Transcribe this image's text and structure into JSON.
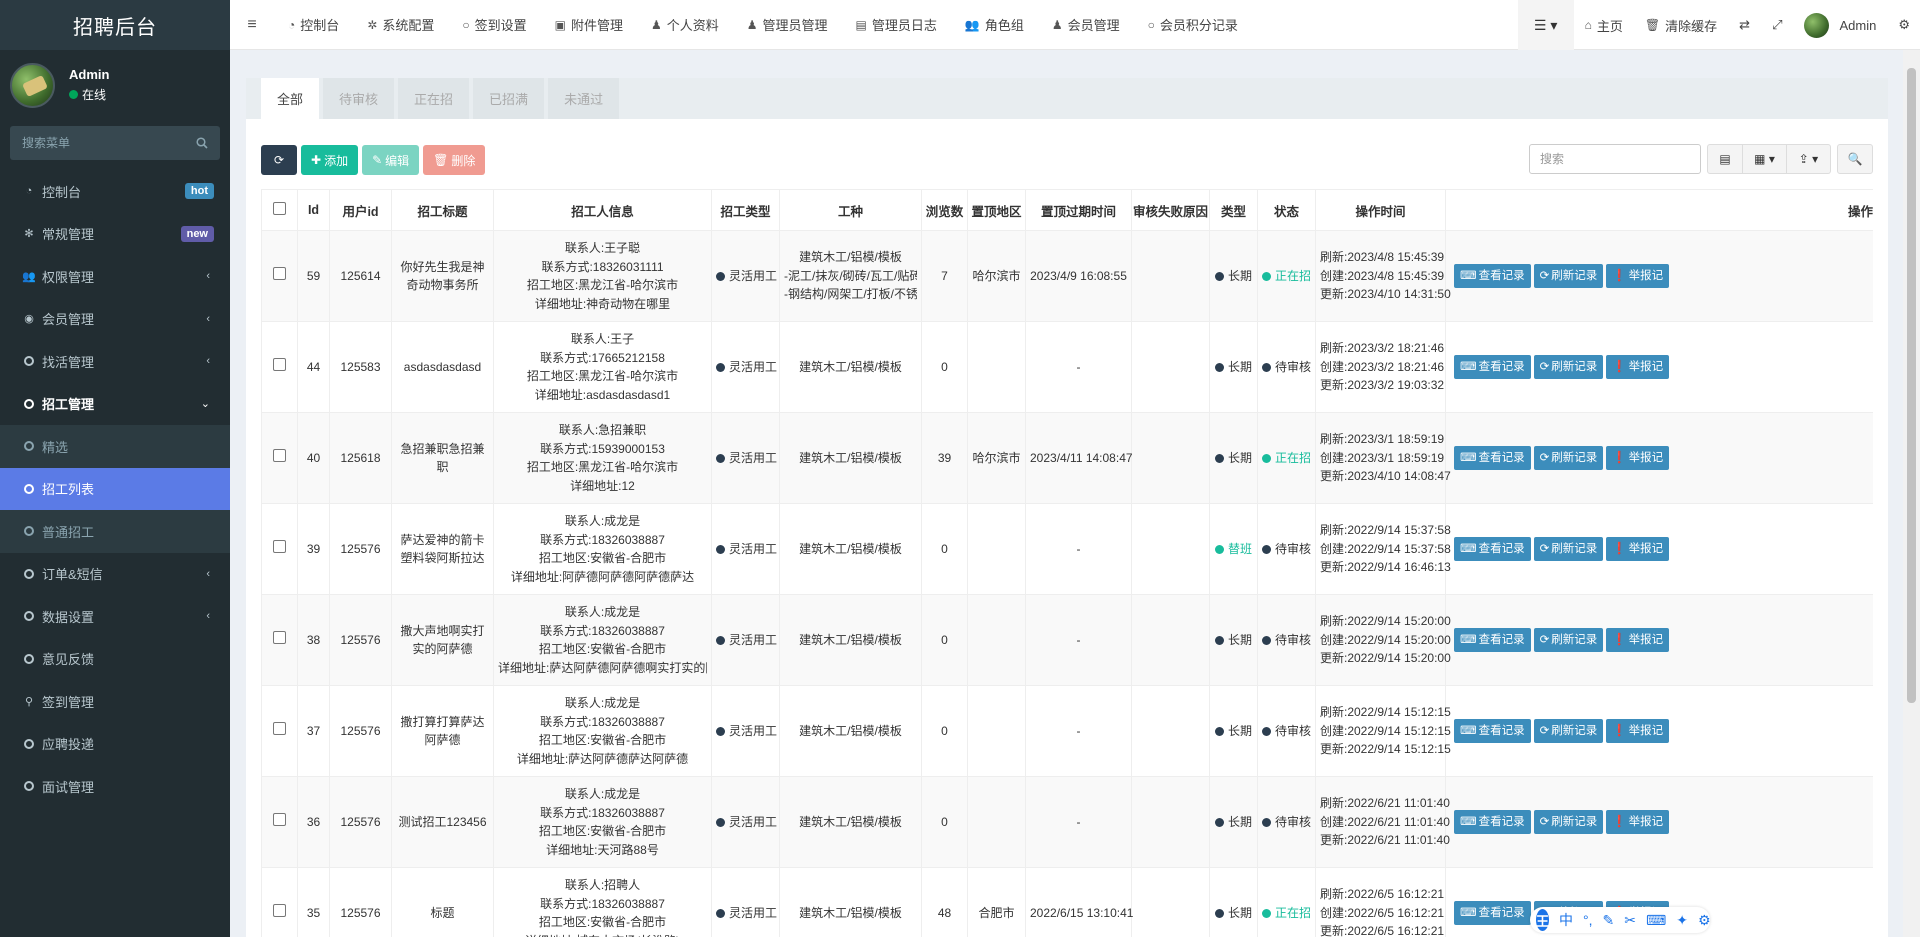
{
  "brand": "招聘后台",
  "user": {
    "name": "Admin",
    "status": "在线"
  },
  "search_menu": {
    "placeholder": "搜索菜单"
  },
  "sidebar": {
    "items": [
      {
        "label": "控制台",
        "icon": "dashboard-icon",
        "badge": "hot"
      },
      {
        "label": "常规管理",
        "icon": "cogs-icon",
        "badge": "new"
      },
      {
        "label": "权限管理",
        "icon": "group-icon"
      },
      {
        "label": "会员管理",
        "icon": "user-circle-icon"
      },
      {
        "label": "找活管理",
        "icon": "circle-icon"
      },
      {
        "label": "招工管理",
        "icon": "circle-icon"
      },
      {
        "label": "订单&短信",
        "icon": "circle-icon"
      },
      {
        "label": "数据设置",
        "icon": "circle-icon"
      },
      {
        "label": "意见反馈",
        "icon": "circle-icon"
      },
      {
        "label": "签到管理",
        "icon": "map-marker-icon"
      },
      {
        "label": "应聘投递",
        "icon": "circle-icon"
      },
      {
        "label": "面试管理",
        "icon": "circle-icon"
      }
    ],
    "submenu": [
      {
        "label": "精选"
      },
      {
        "label": "招工列表"
      },
      {
        "label": "普通招工"
      }
    ]
  },
  "navbar": {
    "links": [
      {
        "label": "控制台",
        "icon": "dashboard-icon"
      },
      {
        "label": "系统配置",
        "icon": "gear-icon"
      },
      {
        "label": "签到设置",
        "icon": "circle-icon"
      },
      {
        "label": "附件管理",
        "icon": "file-image-icon"
      },
      {
        "label": "个人资料",
        "icon": "user-icon"
      },
      {
        "label": "管理员管理",
        "icon": "user-icon"
      },
      {
        "label": "管理员日志",
        "icon": "list-alt-icon"
      },
      {
        "label": "角色组",
        "icon": "group-icon"
      },
      {
        "label": "会员管理",
        "icon": "user-icon"
      },
      {
        "label": "会员积分记录",
        "icon": "circle-icon"
      }
    ],
    "home": "主页",
    "clear_cache": "清除缓存",
    "admin": "Admin"
  },
  "tabs": [
    "全部",
    "待审核",
    "正在招",
    "已招满",
    "未通过"
  ],
  "toolbar": {
    "add": "添加",
    "edit": "编辑",
    "delete": "删除",
    "search_placeholder": "搜索"
  },
  "table": {
    "headers": [
      "Id",
      "用户id",
      "招工标题",
      "招工人信息",
      "招工类型",
      "工种",
      "浏览数",
      "置顶地区",
      "置顶过期时间",
      "审核失败原因",
      "类型",
      "状态",
      "操作时间",
      "操作"
    ],
    "op_labels": [
      "查看记录",
      "刷新记录",
      "举报记"
    ],
    "rows": [
      {
        "id": "59",
        "uid": "125614",
        "title": "你好先生我是神奇动物事务所",
        "info": [
          "联系人:王子聪",
          "联系方式:18326031111",
          "招工地区:黑龙江省-哈尔滨市",
          "详细地址:神奇动物在哪里"
        ],
        "jtype": "灵活用工",
        "trade": [
          "建筑木工/铝模/模板",
          "-泥工/抹灰/砌砖/瓦工/贴砖",
          "-钢结构/网架工/打板/不锈钢"
        ],
        "views": "7",
        "region": "哈尔滨市",
        "expire": "2023/4/9 16:08:55",
        "reason": "",
        "type": "长期",
        "type_green": false,
        "status": "正在招",
        "status_green": true,
        "refresh": "刷新:2023/4/8 15:45:39",
        "create": "创建:2023/4/8 15:45:39",
        "update": "更新:2023/4/10 14:31:50"
      },
      {
        "id": "44",
        "uid": "125583",
        "title": "asdasdasdasd",
        "info": [
          "联系人:王子",
          "联系方式:17665212158",
          "招工地区:黑龙江省-哈尔滨市",
          "详细地址:asdasdasdasd1"
        ],
        "jtype": "灵活用工",
        "trade": [
          "建筑木工/铝模/模板"
        ],
        "views": "0",
        "region": "",
        "expire": "-",
        "reason": "",
        "type": "长期",
        "type_green": false,
        "status": "待审核",
        "status_green": false,
        "refresh": "刷新:2023/3/2 18:21:46",
        "create": "创建:2023/3/2 18:21:46",
        "update": "更新:2023/3/2 19:03:32"
      },
      {
        "id": "40",
        "uid": "125618",
        "title": "急招兼职急招兼职",
        "info": [
          "联系人:急招兼职",
          "联系方式:15939000153",
          "招工地区:黑龙江省-哈尔滨市",
          "详细地址:12"
        ],
        "jtype": "灵活用工",
        "trade": [
          "建筑木工/铝模/模板"
        ],
        "views": "39",
        "region": "哈尔滨市",
        "expire": "2023/4/11 14:08:47",
        "reason": "",
        "type": "长期",
        "type_green": false,
        "status": "正在招",
        "status_green": true,
        "refresh": "刷新:2023/3/1 18:59:19",
        "create": "创建:2023/3/1 18:59:19",
        "update": "更新:2023/4/10 14:08:47"
      },
      {
        "id": "39",
        "uid": "125576",
        "title": "萨达爱神的箭卡塑料袋阿斯拉达",
        "info": [
          "联系人:成龙是",
          "联系方式:18326038887",
          "招工地区:安徽省-合肥市",
          "详细地址:阿萨德阿萨德阿萨德萨达"
        ],
        "jtype": "灵活用工",
        "trade": [
          "建筑木工/铝模/模板"
        ],
        "views": "0",
        "region": "",
        "expire": "-",
        "reason": "",
        "type": "替班",
        "type_green": true,
        "status": "待审核",
        "status_green": false,
        "refresh": "刷新:2022/9/14 15:37:58",
        "create": "创建:2022/9/14 15:37:58",
        "update": "更新:2022/9/14 16:46:13"
      },
      {
        "id": "38",
        "uid": "125576",
        "title": "撒大声地啊实打实的阿萨德",
        "info": [
          "联系人:成龙是",
          "联系方式:18326038887",
          "招工地区:安徽省-合肥市",
          "详细地址:萨达阿萨德阿萨德啊实打实的阿萨"
        ],
        "jtype": "灵活用工",
        "trade": [
          "建筑木工/铝模/模板"
        ],
        "views": "0",
        "region": "",
        "expire": "-",
        "reason": "",
        "type": "长期",
        "type_green": false,
        "status": "待审核",
        "status_green": false,
        "refresh": "刷新:2022/9/14 15:20:00",
        "create": "创建:2022/9/14 15:20:00",
        "update": "更新:2022/9/14 15:20:00"
      },
      {
        "id": "37",
        "uid": "125576",
        "title": "撒打算打算萨达阿萨德",
        "info": [
          "联系人:成龙是",
          "联系方式:18326038887",
          "招工地区:安徽省-合肥市",
          "详细地址:萨达阿萨德萨达阿萨德"
        ],
        "jtype": "灵活用工",
        "trade": [
          "建筑木工/铝模/模板"
        ],
        "views": "0",
        "region": "",
        "expire": "-",
        "reason": "",
        "type": "长期",
        "type_green": false,
        "status": "待审核",
        "status_green": false,
        "refresh": "刷新:2022/9/14 15:12:15",
        "create": "创建:2022/9/14 15:12:15",
        "update": "更新:2022/9/14 15:12:15"
      },
      {
        "id": "36",
        "uid": "125576",
        "title": "测试招工123456",
        "info": [
          "联系人:成龙是",
          "联系方式:18326038887",
          "招工地区:安徽省-合肥市",
          "详细地址:天河路88号"
        ],
        "jtype": "灵活用工",
        "trade": [
          "建筑木工/铝模/模板"
        ],
        "views": "0",
        "region": "",
        "expire": "-",
        "reason": "",
        "type": "长期",
        "type_green": false,
        "status": "待审核",
        "status_green": false,
        "refresh": "刷新:2022/6/21 11:01:40",
        "create": "创建:2022/6/21 11:01:40",
        "update": "更新:2022/6/21 11:01:40"
      },
      {
        "id": "35",
        "uid": "125576",
        "title": "标题",
        "info": [
          "联系人:招聘人",
          "联系方式:18326038887",
          "招工地区:安徽省-合肥市",
          "详细地址:城东大市场(长淮路)"
        ],
        "jtype": "灵活用工",
        "trade": [
          "建筑木工/铝模/模板"
        ],
        "views": "48",
        "region": "合肥市",
        "expire": "2022/6/15 13:10:41",
        "reason": "",
        "type": "长期",
        "type_green": false,
        "status": "正在招",
        "status_green": true,
        "refresh": "刷新:2022/6/5 16:12:21",
        "create": "创建:2022/6/5 16:12:21",
        "update": "更新:2022/6/5 16:12:21"
      }
    ]
  },
  "ime": {
    "logo": "王",
    "mode": "中"
  }
}
